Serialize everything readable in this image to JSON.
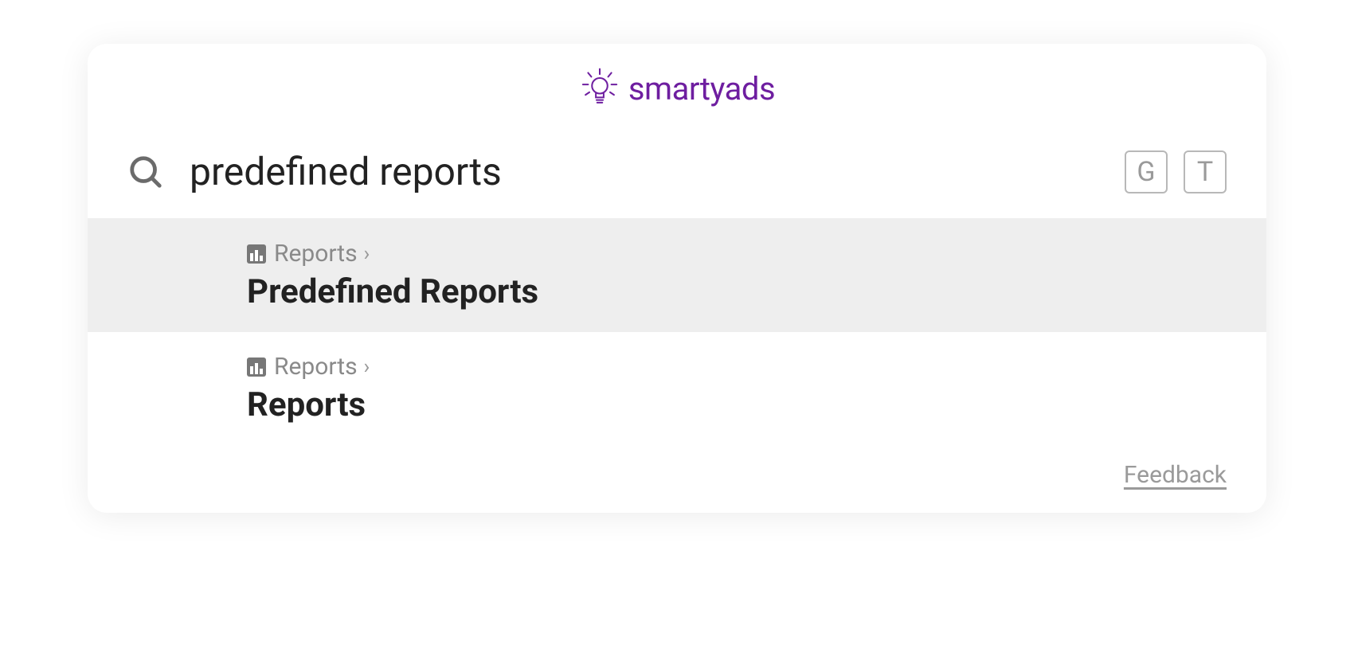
{
  "brand": {
    "name": "smartyads",
    "color": "#6e1ea0"
  },
  "search": {
    "value": "predefined reports",
    "placeholder": ""
  },
  "shortcuts": {
    "key1": "G",
    "key2": "T"
  },
  "results": [
    {
      "breadcrumb": "Reports",
      "title": "Predefined Reports",
      "highlighted": true
    },
    {
      "breadcrumb": "Reports",
      "title": "Reports",
      "highlighted": false
    }
  ],
  "footer": {
    "feedback": "Feedback"
  }
}
